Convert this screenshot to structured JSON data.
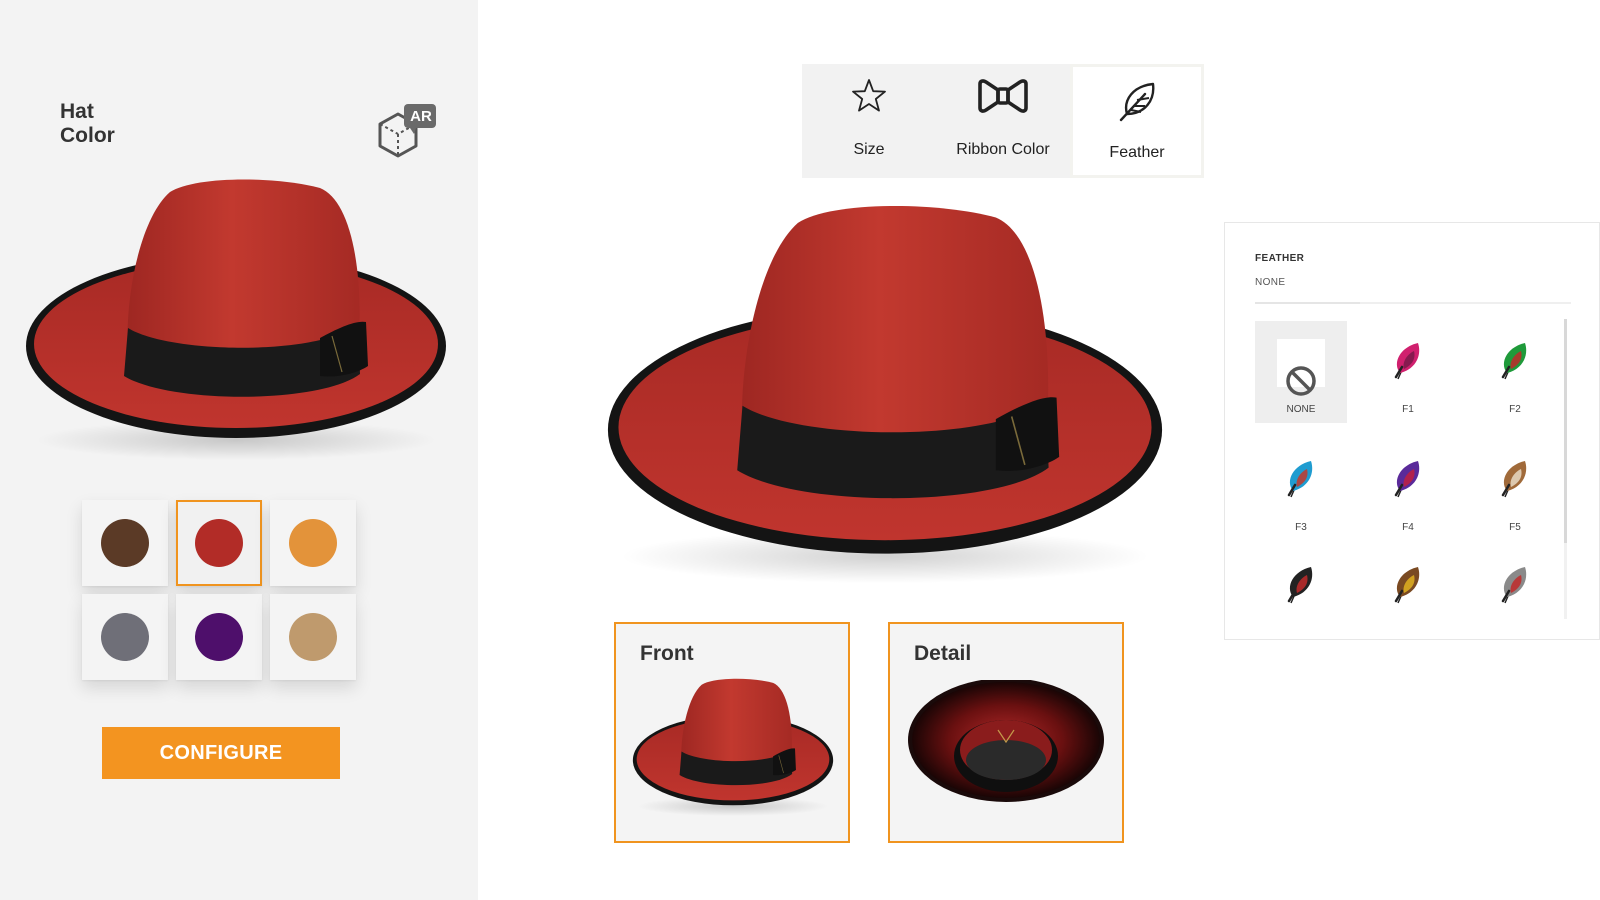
{
  "left_panel": {
    "title_line1": "Hat",
    "title_line2": "Color",
    "ar_label": "AR",
    "swatches": [
      {
        "name": "brown",
        "color": "#5b3a26",
        "selected": false
      },
      {
        "name": "red",
        "color": "#b22c27",
        "selected": true
      },
      {
        "name": "orange",
        "color": "#e3933a",
        "selected": false
      },
      {
        "name": "gray",
        "color": "#6f6f78",
        "selected": false
      },
      {
        "name": "purple",
        "color": "#4e0f6b",
        "selected": false
      },
      {
        "name": "tan",
        "color": "#bf9a6d",
        "selected": false
      }
    ],
    "configure_label": "CONFIGURE"
  },
  "options_bar": {
    "tabs": [
      {
        "label": "Size",
        "icon": "star-icon"
      },
      {
        "label": "Ribbon Color",
        "icon": "bow-tie-icon"
      },
      {
        "label": "Feather",
        "icon": "feather-icon",
        "active": true
      }
    ]
  },
  "views": {
    "front_label": "Front",
    "detail_label": "Detail"
  },
  "feather_panel": {
    "heading": "FEATHER",
    "current_value": "NONE",
    "items": [
      {
        "label": "NONE",
        "icon": "no-symbol-icon",
        "selected": true
      },
      {
        "label": "F1",
        "icon": "pink-feather-icon",
        "colors": [
          "#d0206e",
          "#7a1a4a"
        ]
      },
      {
        "label": "F2",
        "icon": "green-feather-icon",
        "colors": [
          "#1f9a3a",
          "#c02a2a"
        ]
      },
      {
        "label": "F3",
        "icon": "blue-feather-icon",
        "colors": [
          "#1f9cd0",
          "#c4392b"
        ]
      },
      {
        "label": "F4",
        "icon": "purple-feather-icon",
        "colors": [
          "#5a2a9a",
          "#c02040"
        ]
      },
      {
        "label": "F5",
        "icon": "speckled-feather-icon",
        "colors": [
          "#a06a3a",
          "#e8d9c4"
        ]
      },
      {
        "label": "",
        "icon": "dark-feather-icon",
        "colors": [
          "#222222",
          "#c02a2a"
        ]
      },
      {
        "label": "",
        "icon": "gold-feather-icon",
        "colors": [
          "#7a4a22",
          "#e0b020"
        ]
      },
      {
        "label": "",
        "icon": "gray-feather-icon",
        "colors": [
          "#8a8a8a",
          "#c02a2a"
        ]
      }
    ]
  },
  "colors": {
    "accent": "#f39420",
    "hat_red": "#b8322b",
    "band": "#1c1c1c"
  }
}
